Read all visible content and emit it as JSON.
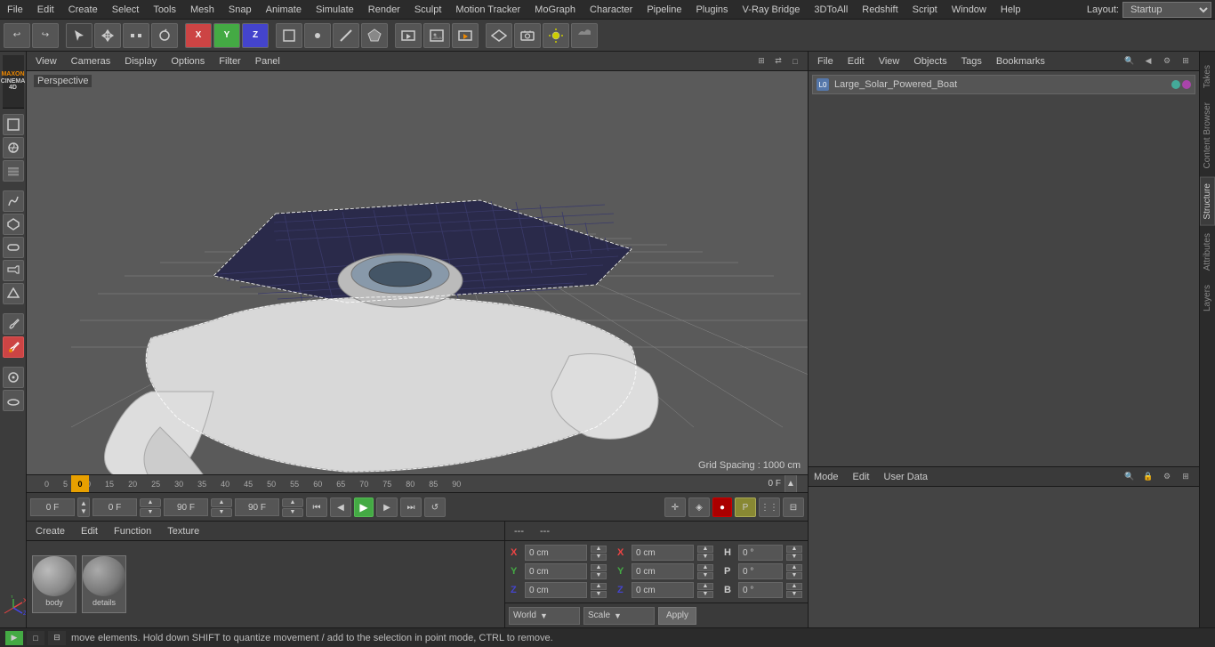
{
  "app": {
    "title": "Cinema 4D"
  },
  "menu": {
    "items": [
      "File",
      "Edit",
      "Create",
      "Select",
      "Tools",
      "Mesh",
      "Snap",
      "Animate",
      "Simulate",
      "Render",
      "Sculpt",
      "Motion Tracker",
      "MoGraph",
      "Character",
      "Pipeline",
      "Plugins",
      "V-Ray Bridge",
      "3DToAll",
      "Redshift",
      "Script",
      "Window",
      "Help"
    ]
  },
  "layout": {
    "label": "Layout:",
    "value": "Startup"
  },
  "viewport": {
    "label": "Perspective",
    "grid_spacing": "Grid Spacing : 1000 cm",
    "menus": [
      "View",
      "Cameras",
      "Display",
      "Options",
      "Filter",
      "Panel"
    ]
  },
  "timeline": {
    "rulers": [
      "0",
      "5",
      "10",
      "15",
      "20",
      "25",
      "30",
      "35",
      "40",
      "45",
      "50",
      "55",
      "60",
      "65",
      "70",
      "75",
      "80",
      "85",
      "90"
    ],
    "current_frame": "0 F",
    "end_frame": "90 F",
    "start_field": "0 F",
    "min_field": "0 F",
    "max_field": "90 F",
    "end_field": "90 F"
  },
  "materials": {
    "menus": [
      "Create",
      "Edit",
      "Function",
      "Texture"
    ],
    "items": [
      {
        "label": "body",
        "type": "sphere"
      },
      {
        "label": "details",
        "type": "sphere"
      }
    ]
  },
  "coordinates": {
    "x_pos": "0 cm",
    "y_pos": "0 cm",
    "z_pos": "0 cm",
    "x_size": "0 cm",
    "y_size": "0 cm",
    "z_size": "0 cm",
    "h_rot": "0 °",
    "p_rot": "0 °",
    "b_rot": "0 °",
    "world_label": "World",
    "scale_label": "Scale",
    "apply_label": "Apply"
  },
  "object_manager": {
    "menus": [
      "File",
      "Edit",
      "View",
      "Objects",
      "Tags",
      "Bookmarks"
    ],
    "items": [
      {
        "label": "Large_Solar_Powered_Boat",
        "icon": "L0",
        "dot1": "green",
        "dot2": "purple"
      }
    ]
  },
  "attributes": {
    "menus": [
      "Mode",
      "Edit",
      "User Data"
    ],
    "dashes_left": "---",
    "dashes_right": "---"
  },
  "status_bar": {
    "text": "move elements. Hold down SHIFT to quantize movement / add to the selection in point mode, CTRL to remove."
  },
  "right_vtabs": [
    "Takes",
    "Content Browser",
    "Structure",
    "Attributes",
    "Layers"
  ],
  "icons": {
    "undo": "↩",
    "redo": "↪",
    "move": "✛",
    "rotate": "↻",
    "scale": "⤢",
    "select_rect": "▢",
    "select_move": "⊕",
    "select_rot": "↺",
    "axis_x": "X",
    "axis_y": "Y",
    "axis_z": "Z",
    "object_mode": "□",
    "play": "▶",
    "stop": "■",
    "prev": "◀",
    "next": "▶",
    "record": "●",
    "rewind": "⏮",
    "forward": "⏭",
    "render": "📷",
    "render_view": "🖼",
    "render_settings": "⚙"
  }
}
